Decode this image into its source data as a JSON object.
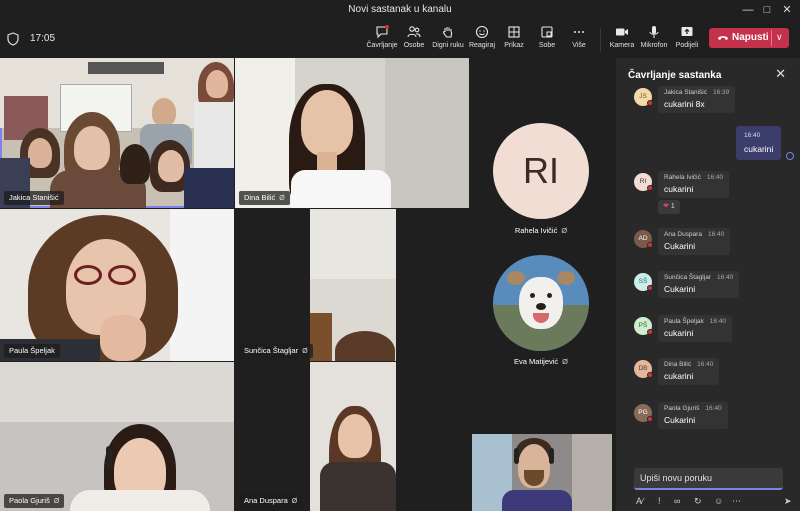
{
  "window": {
    "title": "Novi sastanak u kanalu",
    "controls": [
      "minimize-icon",
      "maximize-icon",
      "close-icon"
    ]
  },
  "toolbar": {
    "timer": "17:05",
    "buttons": [
      {
        "id": "chat",
        "label": "Čavrljanje",
        "icon": "chat-icon"
      },
      {
        "id": "people",
        "label": "Osobe",
        "icon": "people-icon"
      },
      {
        "id": "raise",
        "label": "Digni ruku",
        "icon": "hand-icon"
      },
      {
        "id": "react",
        "label": "Reagiraj",
        "icon": "smiley-icon"
      },
      {
        "id": "view",
        "label": "Prikaz",
        "icon": "grid-icon"
      },
      {
        "id": "rooms",
        "label": "Sobe",
        "icon": "rooms-icon"
      },
      {
        "id": "more",
        "label": "Više",
        "icon": "more-icon"
      },
      {
        "id": "camera",
        "label": "Kamera",
        "icon": "camera-icon"
      },
      {
        "id": "mic",
        "label": "Mikrofon",
        "icon": "mic-icon"
      },
      {
        "id": "share",
        "label": "Podijeli",
        "icon": "share-icon"
      }
    ],
    "leave_label": "Napusti"
  },
  "participants": {
    "tile1": "Jakica Stanišić",
    "tile2": "Dina Bilić",
    "tile3": "Paula Špeljak",
    "tile4": "Sunčica Štagljar",
    "tile5": "Paola Gjuriš",
    "tile6": "Ana Duspara",
    "avatar1_initials": "RI",
    "avatar1_name": "Rahela Ivičić",
    "avatar2_name": "Eva Matijević"
  },
  "chat": {
    "title": "Čavrljanje sastanka",
    "messages": [
      {
        "initials": "JS",
        "author": "Jakica Stanišić",
        "time": "16:39",
        "text": "cukarini 8x"
      },
      {
        "mine": true,
        "time": "16:40",
        "text": "cukarini"
      },
      {
        "initials": "RI",
        "author": "Rahela Ivičić",
        "time": "16:40",
        "text": "cukarini",
        "reaction": "1"
      },
      {
        "initials": "AD",
        "author": "Ana Duspara",
        "time": "16:40",
        "text": "Cukarini"
      },
      {
        "initials": "SŠ",
        "author": "Sunčica Štagljar",
        "time": "16:40",
        "text": "Cukarini"
      },
      {
        "initials": "PŠ",
        "author": "Paula Špeljak",
        "time": "16:40",
        "text": "cukarini"
      },
      {
        "initials": "DB",
        "author": "Dina Bilić",
        "time": "16:40",
        "text": "cukarini"
      },
      {
        "initials": "PG",
        "author": "Paola Gjuriš",
        "time": "16:40",
        "text": "Cukarini"
      }
    ],
    "compose_placeholder": "Upiši novu poruku"
  },
  "colors": {
    "accent": "#7b83eb",
    "leave": "#c4314b",
    "background": "#1f1f1f",
    "panel": "#292929"
  }
}
